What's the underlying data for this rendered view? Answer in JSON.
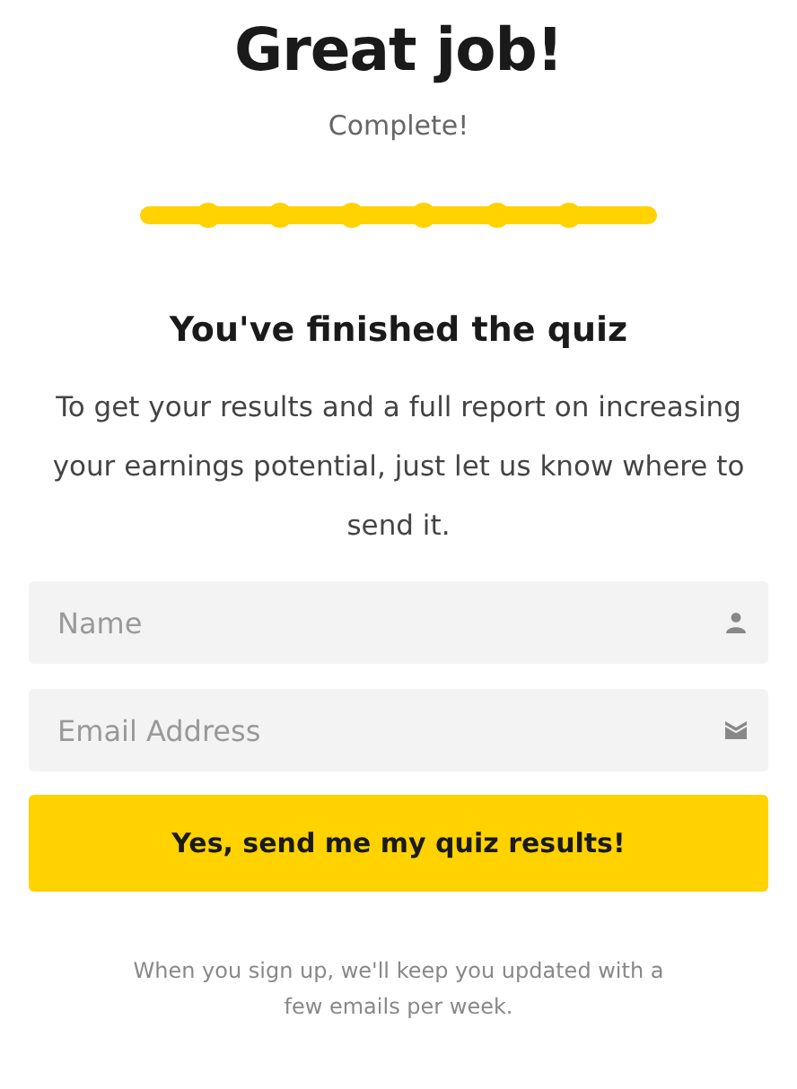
{
  "title": "Great job!",
  "status": "Complete!",
  "progress": {
    "level": 1
  },
  "heading": "You've finished the quiz",
  "description": "To get your results and a full report on increasing your earnings potential, just let us know where to send it.",
  "fields": [
    {
      "kind": "name",
      "placeholder": "Name"
    },
    {
      "kind": "email",
      "placeholder": "Email Address"
    }
  ],
  "submit_button": "Yes, send me my quiz results!",
  "footnote": "When you sign up, we'll keep you updated with a few emails per week."
}
